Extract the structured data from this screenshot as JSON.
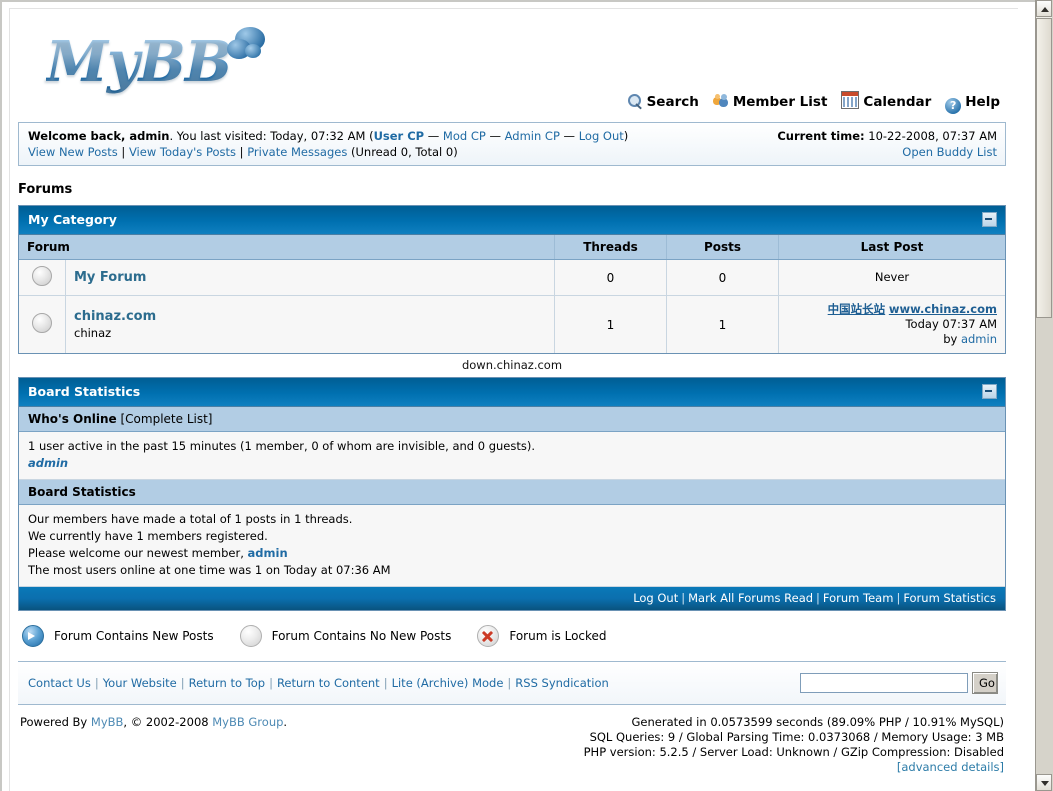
{
  "brand": {
    "logo_text": "MyBB",
    "logo_icon": "speech-bubble-icon"
  },
  "topnav": [
    {
      "label": "Search",
      "icon": "search-icon"
    },
    {
      "label": "Member List",
      "icon": "members-icon"
    },
    {
      "label": "Calendar",
      "icon": "calendar-icon"
    },
    {
      "label": "Help",
      "icon": "help-icon"
    }
  ],
  "welcome": {
    "greeting_bold": "Welcome back, admin",
    "greeting_rest": ". You last visited: Today, 07:32 AM (",
    "user_cp": "User CP",
    "dash1": " — ",
    "mod_cp": "Mod CP",
    "dash2": " — ",
    "admin_cp": "Admin CP",
    "dash3": " — ",
    "log_out": "Log Out",
    "close_paren": ")",
    "view_new_posts": "View New Posts",
    "view_todays_posts": "View Today's Posts",
    "private_messages": "Private Messages",
    "pm_counts": " (Unread 0, Total 0)",
    "current_time_label": "Current time:",
    "current_time_value": " 10-22-2008, 07:37 AM",
    "open_buddy_list": "Open Buddy List"
  },
  "page_title": "Forums",
  "category": {
    "title": "My Category",
    "collapse_icon": "minus-icon",
    "columns": [
      "Forum",
      "Threads",
      "Posts",
      "Last Post"
    ],
    "rows": [
      {
        "status_icon": "forum-no-new-posts-icon",
        "name": "My Forum",
        "description": "",
        "threads": "0",
        "posts": "0",
        "last_post_never": "Never",
        "last_post_title": "",
        "last_post_time": "",
        "last_post_by_label": "",
        "last_post_author": ""
      },
      {
        "status_icon": "forum-no-new-posts-icon",
        "name": "chinaz.com",
        "description": "chinaz",
        "threads": "1",
        "posts": "1",
        "last_post_never": "",
        "last_post_title_cn": "中国站长站",
        "last_post_title_url": "www.chinaz.com",
        "last_post_time": "Today 07:37 AM",
        "last_post_by_label": "by ",
        "last_post_author": "admin"
      }
    ]
  },
  "watermark": "down.chinaz.com",
  "board_statistics": {
    "title": "Board Statistics",
    "collapse_icon": "minus-icon",
    "whos_online": {
      "heading": "Who's Online",
      "complete_list": " [Complete List]",
      "summary": "1 user active in the past 15 minutes (1 member, 0 of whom are invisible, and 0 guests).",
      "users": [
        "admin"
      ]
    },
    "stats": {
      "heading": "Board Statistics",
      "lines": [
        "Our members have made a total of 1 posts in 1 threads.",
        "We currently have 1 members registered."
      ],
      "welcome_prefix": "Please welcome our newest member, ",
      "newest_member": "admin",
      "most_online": "The most users online at one time was 1 on Today at 07:36 AM"
    },
    "footer_links": [
      "Log Out",
      "Mark All Forums Read",
      "Forum Team",
      "Forum Statistics"
    ]
  },
  "legend": [
    {
      "icon": "forum-new-posts-icon",
      "label": "Forum Contains New Posts"
    },
    {
      "icon": "forum-no-new-posts-icon",
      "label": "Forum Contains No New Posts"
    },
    {
      "icon": "forum-locked-icon",
      "label": "Forum is Locked"
    }
  ],
  "bottom_bar": {
    "links": [
      "Contact Us",
      "Your Website",
      "Return to Top",
      "Return to Content",
      "Lite (Archive) Mode",
      "RSS Syndication"
    ],
    "search_value": "",
    "search_placeholder": "",
    "go_label": "Go"
  },
  "footer": {
    "powered_prefix": "Powered By ",
    "mybb_link": "MyBB",
    "copyright_mid": ", © 2002-2008 ",
    "group_link": "MyBB Group",
    "period": ".",
    "stat_lines": [
      "Generated in 0.0573599 seconds (89.09% PHP / 10.91% MySQL)",
      "SQL Queries: 9 / Global Parsing Time: 0.0373068 / Memory Usage: 3 MB",
      "PHP version: 5.2.5 / Server Load: Unknown / GZip Compression: Disabled"
    ],
    "advanced_details": "[advanced details]"
  },
  "colors": {
    "header_blue": "#0070b0",
    "subheader_blue": "#b2cde4",
    "link_blue": "#206ba4",
    "online_green": "#2e7d32"
  }
}
